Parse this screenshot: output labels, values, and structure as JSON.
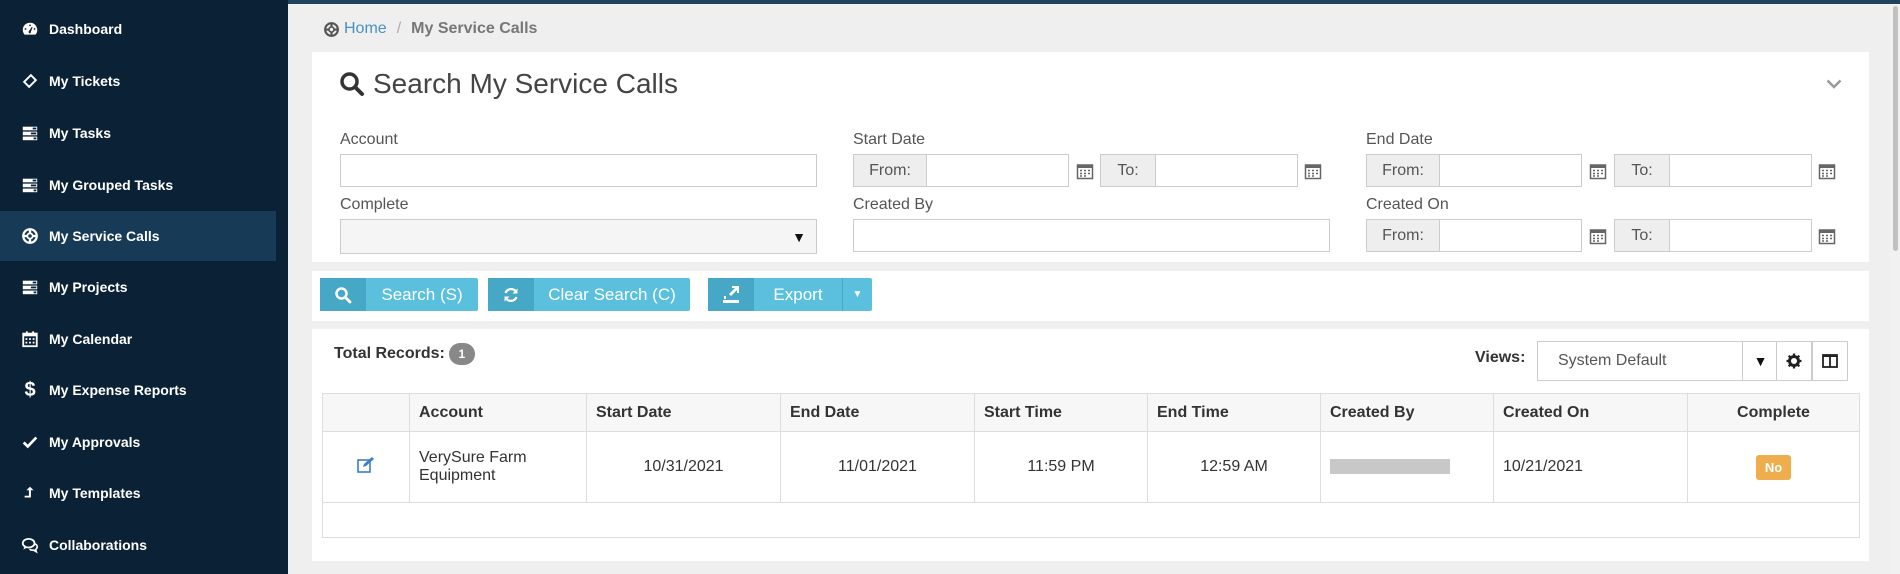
{
  "sidebar": {
    "items": [
      {
        "label": "Dashboard",
        "icon": "dashboard-icon"
      },
      {
        "label": "My Tickets",
        "icon": "ticket-icon"
      },
      {
        "label": "My Tasks",
        "icon": "tasks-icon"
      },
      {
        "label": "My Grouped Tasks",
        "icon": "tasks-icon"
      },
      {
        "label": "My Service Calls",
        "icon": "lifering-icon"
      },
      {
        "label": "My Projects",
        "icon": "tasks-icon"
      },
      {
        "label": "My Calendar",
        "icon": "calendar-icon"
      },
      {
        "label": "My Expense Reports",
        "icon": "dollar-icon"
      },
      {
        "label": "My Approvals",
        "icon": "check-icon"
      },
      {
        "label": "My Templates",
        "icon": "upload-arrow-icon"
      },
      {
        "label": "Collaborations",
        "icon": "comments-icon"
      }
    ],
    "active": "My Service Calls"
  },
  "breadcrumb": {
    "home": "Home",
    "sep": "/",
    "current": "My Service Calls"
  },
  "search": {
    "title": "Search My Service Calls",
    "account_label": "Account",
    "account_value": "",
    "complete_label": "Complete",
    "complete_value": "",
    "start_date_label": "Start Date",
    "end_date_label": "End Date",
    "created_by_label": "Created By",
    "created_by_value": "",
    "created_on_label": "Created On",
    "from": "From:",
    "to": "To:"
  },
  "buttons": {
    "search": "Search (S)",
    "clear": "Clear Search (C)",
    "export": "Export"
  },
  "records": {
    "total_label": "Total Records:",
    "total": "1"
  },
  "views": {
    "label": "Views:",
    "selected": "System Default"
  },
  "table": {
    "headers": [
      "Account",
      "Start Date",
      "End Date",
      "Start Time",
      "End Time",
      "Created By",
      "Created On",
      "Complete"
    ],
    "rows": [
      {
        "account_line1": "VerySure Farm",
        "account_line2": "Equipment",
        "start_date": "10/31/2021",
        "end_date": "11/01/2021",
        "start_time": "11:59 PM",
        "end_time": "12:59 AM",
        "created_by": "",
        "created_on": "10/21/2021",
        "complete": "No"
      }
    ]
  },
  "colors": {
    "sidebar_bg": "#0b2236",
    "sidebar_active": "#173a56",
    "button": "#5bc0de",
    "badge_no": "#f0ad4e",
    "link": "#4a90c2"
  }
}
